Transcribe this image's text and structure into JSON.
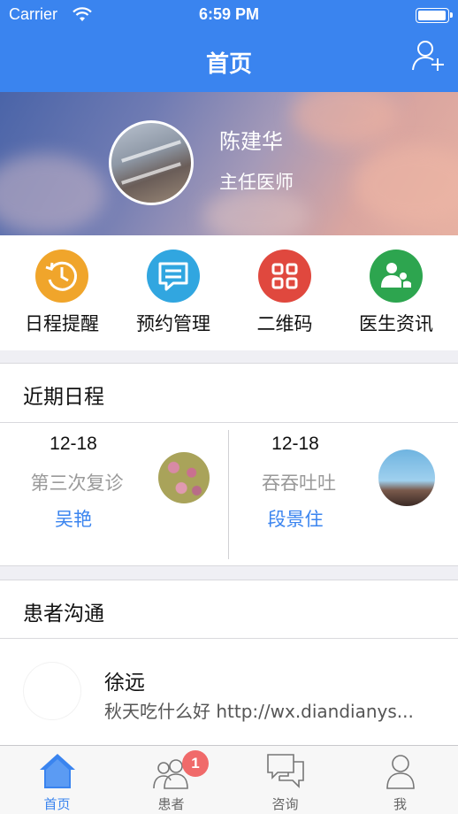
{
  "status_bar": {
    "carrier": "Carrier",
    "time": "6:59 PM"
  },
  "nav": {
    "title": "首页",
    "action_icon": "add-user-icon"
  },
  "profile": {
    "name": "陈建华",
    "title": "主任医师"
  },
  "quick_actions": [
    {
      "label": "日程提醒",
      "icon": "clock-history-icon",
      "color": "#f0a52b"
    },
    {
      "label": "预约管理",
      "icon": "message-icon",
      "color": "#31a6e0"
    },
    {
      "label": "二维码",
      "icon": "grid-icon",
      "color": "#e0483e"
    },
    {
      "label": "医生资讯",
      "icon": "people-icon",
      "color": "#2da54f"
    }
  ],
  "schedule": {
    "title": "近期日程",
    "items": [
      {
        "date": "12-18",
        "desc": "第三次复诊",
        "patient": "吴艳"
      },
      {
        "date": "12-18",
        "desc": "吞吞吐吐",
        "patient": "段景住"
      }
    ]
  },
  "communication": {
    "title": "患者沟通",
    "messages": [
      {
        "name": "徐远",
        "message": "秋天吃什么好 http://wx.diandianys..."
      }
    ]
  },
  "tabbar": {
    "tabs": [
      {
        "label": "首页",
        "icon": "home-icon",
        "active": true
      },
      {
        "label": "患者",
        "icon": "patients-icon",
        "badge": "1"
      },
      {
        "label": "咨询",
        "icon": "chat-bubbles-icon"
      },
      {
        "label": "我",
        "icon": "person-icon"
      }
    ]
  },
  "colors": {
    "primary": "#3a84ef",
    "badge": "#f06a6a"
  }
}
